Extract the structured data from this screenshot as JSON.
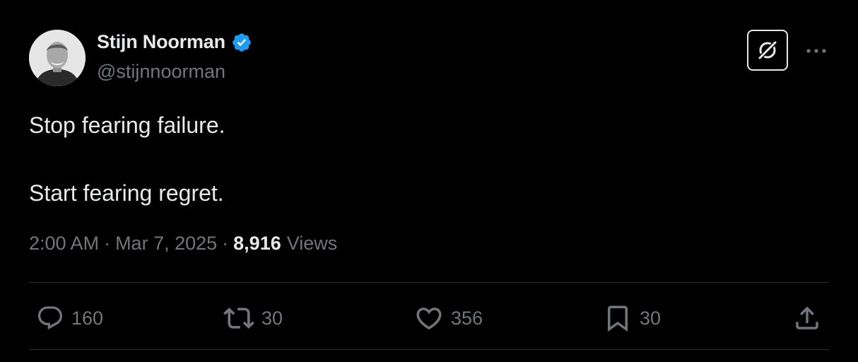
{
  "author": {
    "display_name": "Stijn Noorman",
    "handle": "@stijnnoorman"
  },
  "tweet": {
    "text": "Stop fearing failure.\n\nStart fearing regret.",
    "time": "2:00 AM",
    "separator_1": "·",
    "date": "Mar 7, 2025",
    "separator_2": "·",
    "views_count": "8,916",
    "views_label": "Views"
  },
  "actions": {
    "replies": "160",
    "reposts": "30",
    "likes": "356",
    "bookmarks": "30"
  },
  "icons": [
    "verified-badge-icon",
    "grok-icon",
    "more-icon",
    "reply-icon",
    "repost-icon",
    "like-icon",
    "bookmark-icon",
    "share-icon"
  ],
  "colors": {
    "background": "#000000",
    "primary_text": "#e7e9ea",
    "secondary_text": "#71767b",
    "verified": "#1d9bf0",
    "divider": "#2f3336"
  }
}
